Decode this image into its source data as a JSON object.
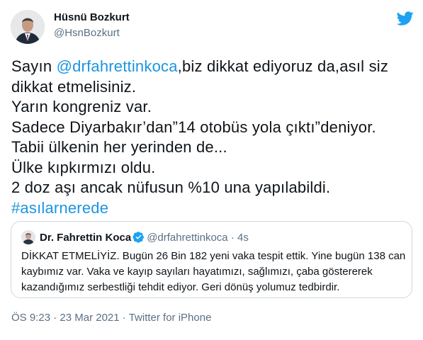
{
  "author": {
    "name": "Hüsnü Bozkurt",
    "handle": "@HsnBozkurt"
  },
  "tweet": {
    "line1_prefix": "Sayın ",
    "line1_mention": "@drfahrettinkoca",
    "line1_suffix": ",biz dikkat ediyoruz da,asıl siz",
    "line2": "dikkat etmelisiniz.",
    "line3": "Yarın kongreniz var.",
    "line4": "Sadece Diyarbakır’dan”14 otobüs yola çıktı”deniyor.",
    "line5": "Tabii ülkenin her yerinden de...",
    "line6": "Ülke kıpkırmızı oldu.",
    "line7": "2 doz aşı ancak nüfusun %10 una yapılabildi.",
    "hashtag": "#asılarnerede"
  },
  "quoted": {
    "name": "Dr. Fahrettin Koca",
    "handle": "@drfahrettinkoca",
    "separator": "·",
    "time": "4s",
    "text_lines": [
      "DİKKAT ETMELİYİZ. Bugün 26 Bin 182 yeni vaka tespit ettik. Yine bugün 138 can",
      "kaybımız var. Vaka ve kayıp sayıları hayatımızı, sağlımızı, çaba göstererek",
      "kazandığımız serbestliği tehdit ediyor. Geri dönüş yolumuz tedbirdir."
    ]
  },
  "meta": {
    "time": "ÖS 9:23",
    "separator1": " · ",
    "date": "23 Mar 2021",
    "separator2": " · ",
    "source": "Twitter for iPhone"
  },
  "colors": {
    "link": "#1b95e0",
    "secondary_text": "#5b7083",
    "border": "#cfd9de",
    "twitter_blue": "#1da1f2"
  },
  "icons": {
    "logo": "twitter-bird-icon",
    "verified": "verified-badge-icon"
  }
}
